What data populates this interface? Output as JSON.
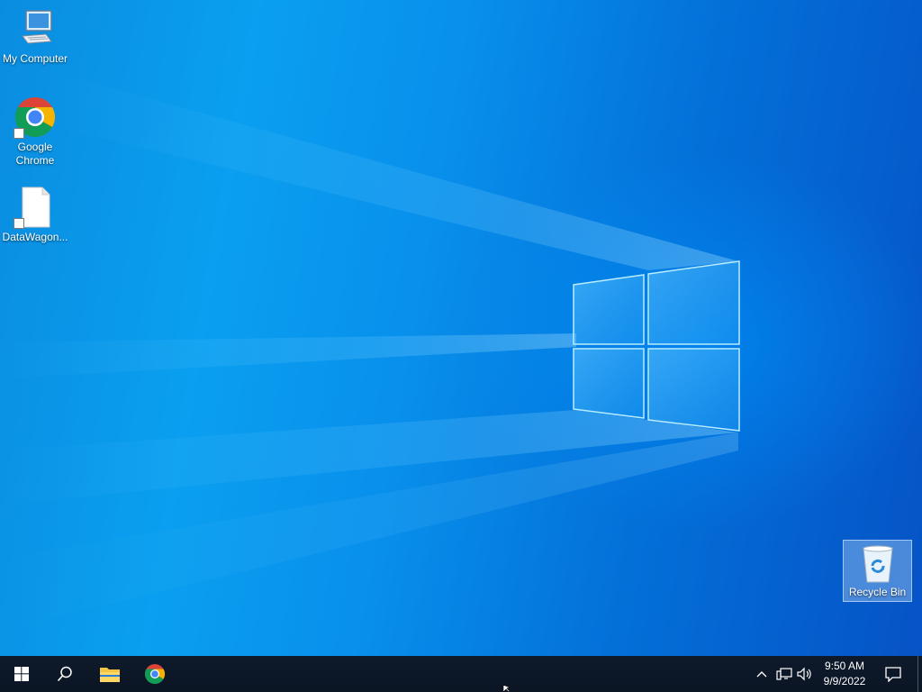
{
  "desktop": {
    "icons": [
      {
        "label": "My Computer",
        "icon": "computer-icon"
      },
      {
        "label": "Google Chrome",
        "icon": "chrome-icon"
      },
      {
        "label": "DataWagon...",
        "icon": "file-shortcut-icon"
      },
      {
        "label": "Recycle Bin",
        "icon": "recycle-bin-icon"
      }
    ]
  },
  "taskbar": {
    "start": {
      "icon": "windows-logo-icon"
    },
    "search": {
      "icon": "search-icon"
    },
    "pinned": [
      {
        "icon": "file-explorer-icon"
      },
      {
        "icon": "chrome-icon"
      }
    ],
    "tray": {
      "icons": [
        "chevron-up-icon",
        "network-icon",
        "volume-icon"
      ],
      "time": "9:50 AM",
      "date": "9/9/2022",
      "notification_icon": "action-center-icon"
    }
  },
  "colors": {
    "desktop_accent": "#0a8de0",
    "taskbar_bg": "#0e1a2b"
  }
}
